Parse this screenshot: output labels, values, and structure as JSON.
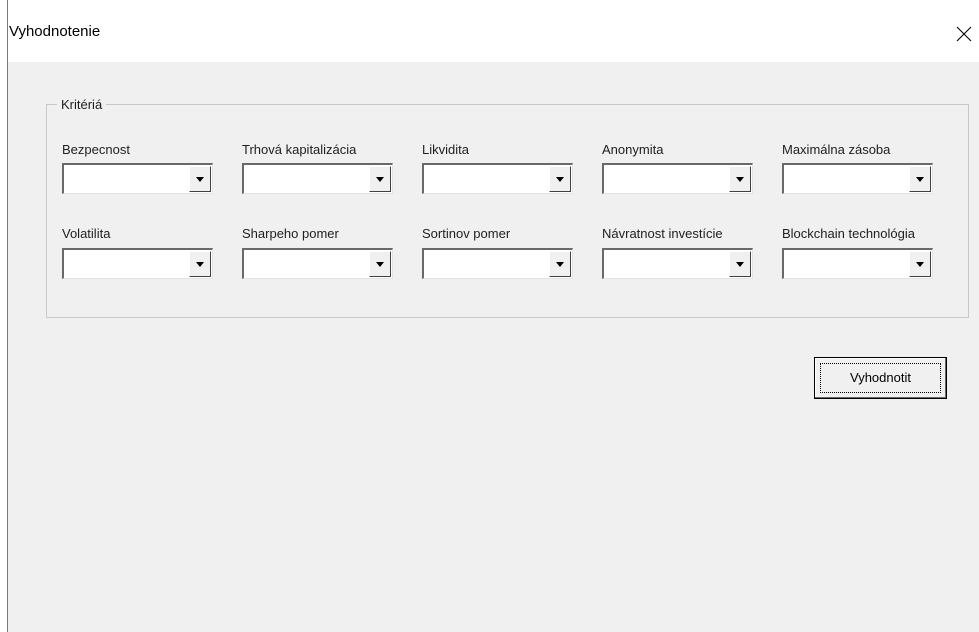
{
  "window": {
    "title": "Vyhodnotenie",
    "close_icon": "close-icon"
  },
  "group": {
    "legend": "Kritériá",
    "rows": [
      {
        "fields": [
          {
            "key": "bezpecnost",
            "label": "Bezpecnost",
            "value": ""
          },
          {
            "key": "trhova-kapitalizacia",
            "label": "Trhová kapitalizácia",
            "value": ""
          },
          {
            "key": "likvidita",
            "label": "Likvidita",
            "value": ""
          },
          {
            "key": "anonymita",
            "label": "Anonymita",
            "value": ""
          },
          {
            "key": "maximalna-zasoba",
            "label": "Maximálna zásoba",
            "value": ""
          }
        ]
      },
      {
        "fields": [
          {
            "key": "volatilita",
            "label": "Volatilita",
            "value": ""
          },
          {
            "key": "sharpeho-pomer",
            "label": "Sharpeho pomer",
            "value": ""
          },
          {
            "key": "sortinov-pomer",
            "label": "Sortinov pomer",
            "value": ""
          },
          {
            "key": "navratnost-investicie",
            "label": "Návratnost investície",
            "value": ""
          },
          {
            "key": "blockchain-technologia",
            "label": "Blockchain technológia",
            "value": ""
          }
        ]
      }
    ]
  },
  "actions": {
    "evaluate_label": "Vyhodnotit"
  },
  "icons": {
    "dropdown": "chevron-down-icon"
  }
}
